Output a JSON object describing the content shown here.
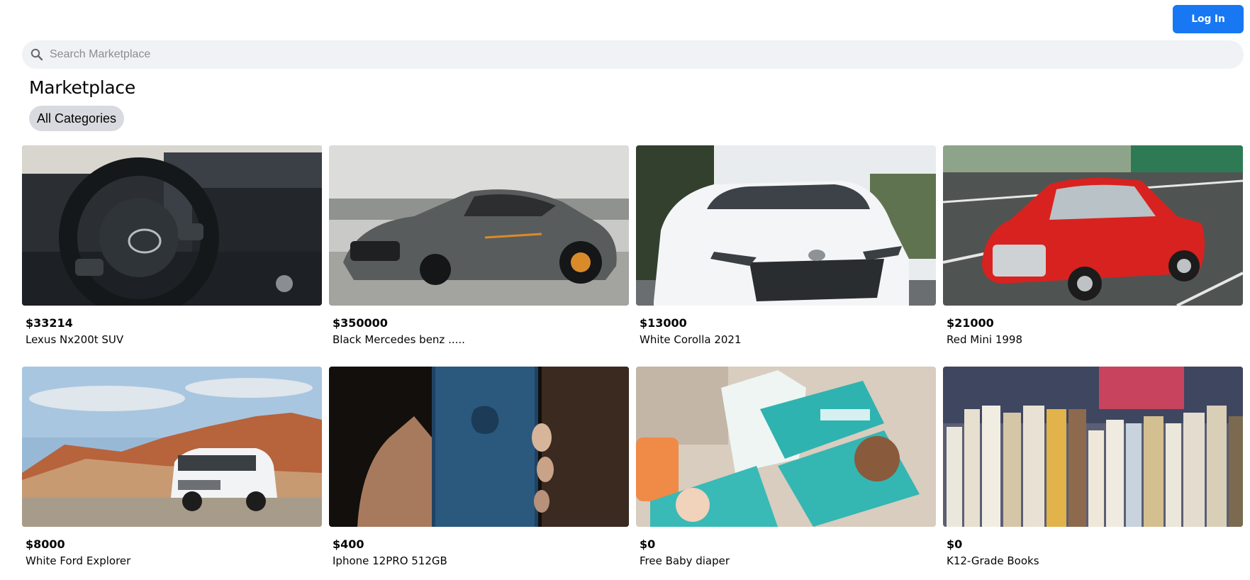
{
  "header": {
    "login_label": "Log In"
  },
  "search": {
    "placeholder": "Search Marketplace",
    "icon": "search-icon"
  },
  "page": {
    "title": "Marketplace",
    "category_chip": "All Categories"
  },
  "colors": {
    "accent": "#1877f2",
    "search_bg": "#f0f2f5",
    "chip_bg": "#d8dadf"
  },
  "listings": [
    {
      "price": "$33214",
      "title": "Lexus Nx200t SUV",
      "image": "car-interior-steering-wheel"
    },
    {
      "price": "$350000",
      "title": "Black Mercedes benz .....",
      "image": "grey-sports-car"
    },
    {
      "price": "$13000",
      "title": "White Corolla 2021",
      "image": "white-sedan"
    },
    {
      "price": "$21000",
      "title": "Red Mini 1998",
      "image": "red-mini-car"
    },
    {
      "price": "$8000",
      "title": "White Ford Explorer",
      "image": "white-suv-desert"
    },
    {
      "price": "$400",
      "title": "Iphone 12PRO 512GB",
      "image": "hand-holding-phone"
    },
    {
      "price": "$0",
      "title": "Free Baby diaper",
      "image": "diaper-packs"
    },
    {
      "price": "$0",
      "title": "K12-Grade Books",
      "image": "row-of-books"
    }
  ]
}
